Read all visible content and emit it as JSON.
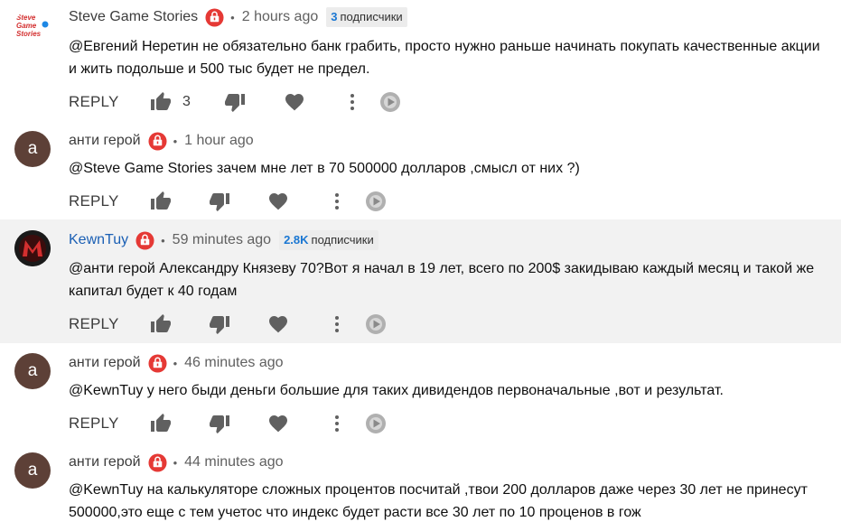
{
  "comments": [
    {
      "author": "Steve Game Stories",
      "time": "2 hours ago",
      "subscribers_num": "3",
      "subscribers_word": "подписчики",
      "avatar_text": "Steve\nGame\nStories",
      "text": "@Евгений Неретин  не обязательно банк грабить, просто нужно раньше начинать покупать качественные акции  и жить подольше и 500 тыс будет не предел.",
      "likes": "3",
      "reply": "REPLY"
    },
    {
      "author": "анти герой",
      "time": "1 hour ago",
      "avatar_letter": "a",
      "text": "@Steve Game Stories  зачем мне лет в 70 500000 долларов ,смысл от них ?)",
      "likes": "",
      "reply": "REPLY"
    },
    {
      "author": "KewnTuy",
      "time": "59 minutes ago",
      "subscribers_num": "2.8K",
      "subscribers_word": "подписчики",
      "text": "@анти герой  Александру Князеву 70?Вот я начал в 19 лет, всего по 200$ закидываю каждый месяц и такой же капитал будет к 40 годам",
      "likes": "",
      "reply": "REPLY"
    },
    {
      "author": "анти герой",
      "time": "46 minutes ago",
      "avatar_letter": "a",
      "text": "@KewnTuy  у него быди деньги большие для таких дивидендов первоначальные ,вот и результат.",
      "likes": "",
      "reply": "REPLY"
    },
    {
      "author": "анти герой",
      "time": "44 minutes ago",
      "avatar_letter": "a",
      "text": "@KewnTuy  на калькуляторе сложных процентов посчитай ,твои 200 долларов даже через 30 лет не принесут 500000,это еще с тем учетос что индекс будет расти все 30 лет по 10 проценов в гож",
      "likes": "",
      "reply": "REPLY"
    }
  ],
  "colors": {
    "sponsor_red": "#e53935",
    "avatar_brown": "#5d4037",
    "highlight_bg": "#f2f2f2",
    "link_blue": "#1a5fb4"
  }
}
